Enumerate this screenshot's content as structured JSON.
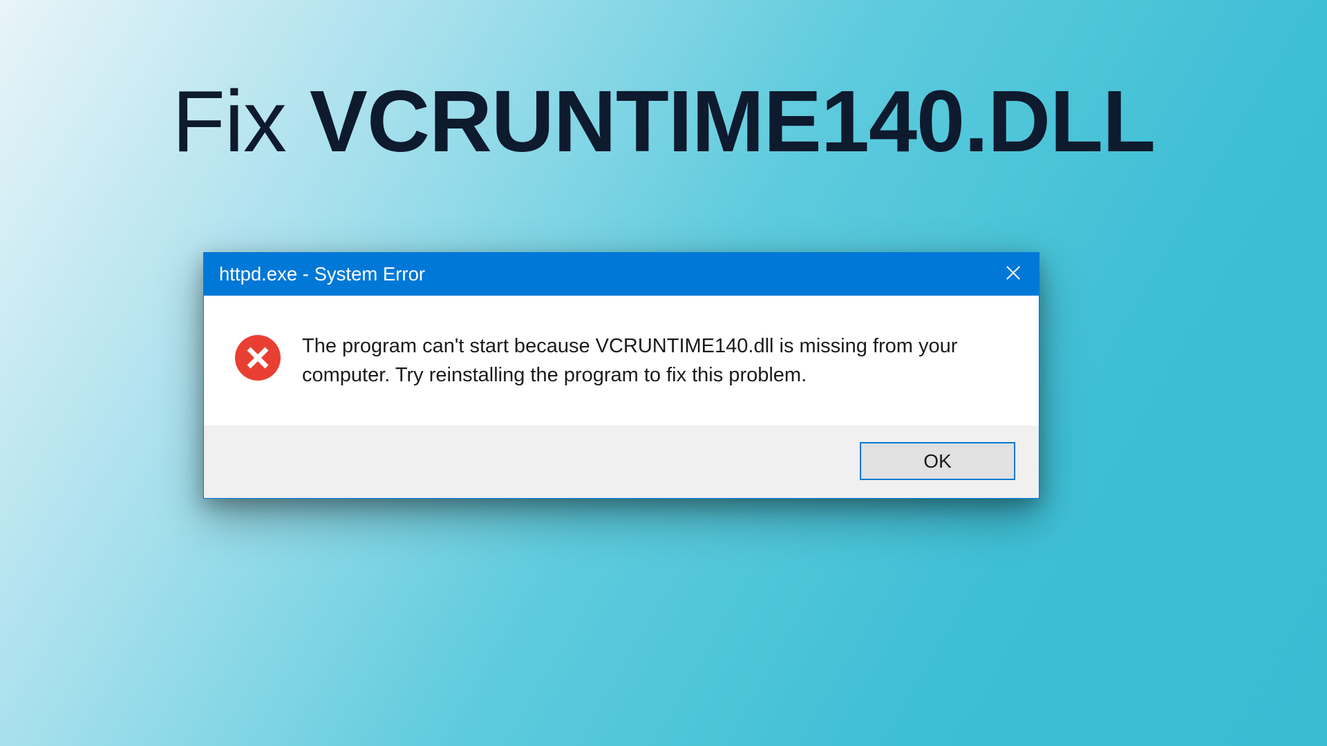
{
  "heading": {
    "prefix": "Fix ",
    "main": "VCRUNTIME140.DLL"
  },
  "dialog": {
    "title": "httpd.exe - System Error",
    "message": "The program can't start because VCRUNTIME140.dll is missing from your computer. Try reinstalling the program to fix this problem.",
    "ok_label": "OK"
  },
  "icons": {
    "close": "close-icon",
    "error": "error-icon"
  },
  "colors": {
    "accent": "#0078d7",
    "error_red": "#e93f33",
    "heading_dark": "#0e1a2e"
  }
}
